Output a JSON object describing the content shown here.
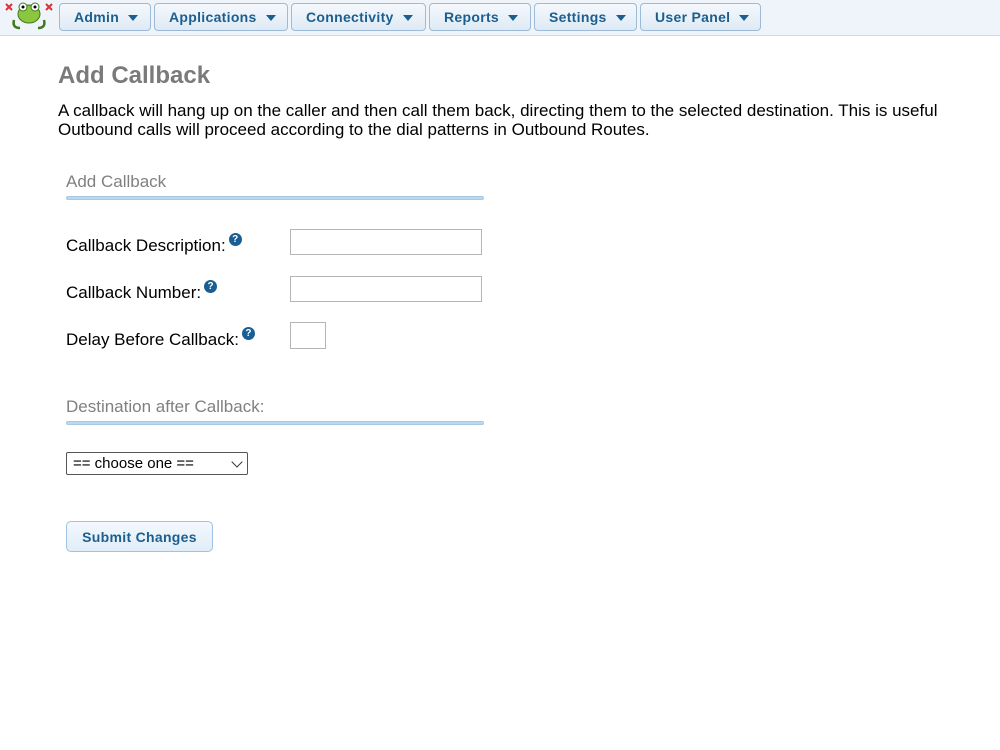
{
  "nav": {
    "items": [
      {
        "label": "Admin"
      },
      {
        "label": "Applications"
      },
      {
        "label": "Connectivity"
      },
      {
        "label": "Reports"
      },
      {
        "label": "Settings"
      },
      {
        "label": "User Panel"
      }
    ]
  },
  "page": {
    "title": "Add Callback",
    "description_line1": "A callback will hang up on the caller and then call them back, directing them to the selected destination. This is useful",
    "description_line2": "Outbound calls will proceed according to the dial patterns in Outbound Routes."
  },
  "form": {
    "section_title": "Add Callback",
    "description_label": "Callback Description:",
    "description_value": "",
    "number_label": "Callback Number:",
    "number_value": "",
    "delay_label": "Delay Before Callback:",
    "delay_value": "",
    "help_glyph": "?",
    "destination_section": "Destination after Callback:",
    "destination_selected": "== choose one ==",
    "submit_label": "Submit Changes"
  },
  "colors": {
    "nav_text": "#1c5f8e",
    "title_gray": "#7a7a7a",
    "help_icon": "#1a5f93",
    "section_rule": "#bcd8ee"
  }
}
